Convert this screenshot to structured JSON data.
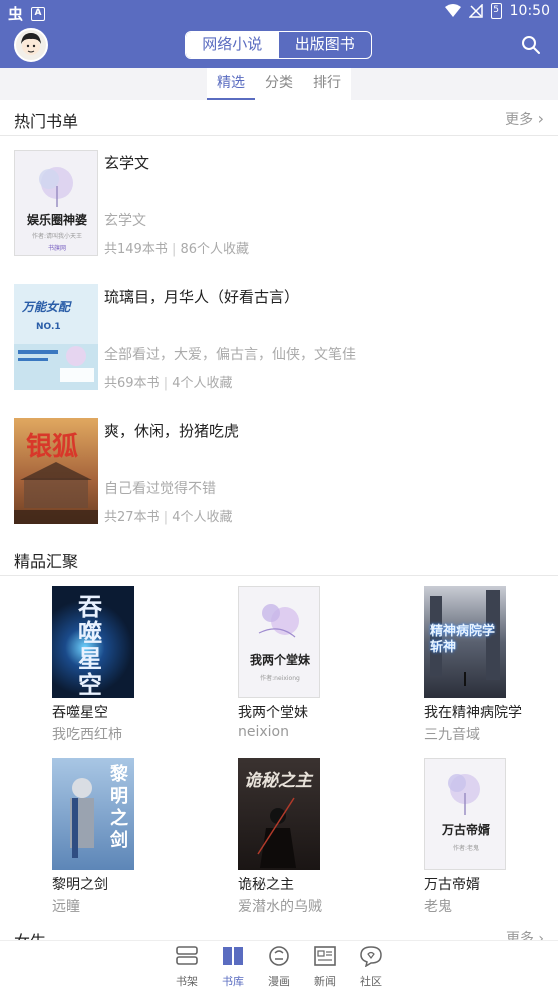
{
  "status_bar": {
    "left_glyph": "虫",
    "box_glyph": "A",
    "battery": "5",
    "time": "10:50"
  },
  "header": {
    "tabs": [
      {
        "label": "网络小说"
      },
      {
        "label": "出版图书"
      }
    ]
  },
  "sub_tabs": [
    {
      "label": "精选"
    },
    {
      "label": "分类"
    },
    {
      "label": "排行"
    }
  ],
  "hot_lists": {
    "title": "热门书单",
    "more": "更多",
    "items": [
      {
        "title": "玄学文",
        "desc": "玄学文",
        "count": "共149本书",
        "fav": "86个人收藏",
        "cover_title": "娱乐圈神婆",
        "cover_author": "作者:请叫我小天王",
        "cover_badge": "书旗网",
        "cover_color": "#f2f1f6"
      },
      {
        "title": "琉璃目，月华人（好看古言）",
        "desc": "全部看过，大爱，偏古言，仙侠，文笔佳",
        "count": "共69本书",
        "fav": "4个人收藏",
        "cover_title": "万能女配",
        "cover_badge": "NO.1",
        "cover_color": "#dfeef6"
      },
      {
        "title": "爽，休闲，扮猪吃虎",
        "desc": "自己看过觉得不错",
        "count": "共27本书",
        "fav": "4个人收藏",
        "cover_title": "银狐",
        "cover_color": "#b9743f"
      }
    ]
  },
  "featured": {
    "title": "精品汇聚",
    "books": [
      {
        "title": "吞噬星空",
        "author": "我吃西红柿",
        "cover_text": "吞噬星空",
        "cover_color": "#0b1b33"
      },
      {
        "title": "我两个堂妹",
        "author": "neixion",
        "cover_text": "我两个堂妹",
        "cover_author": "作者:neixiong",
        "cover_color": "#f4f3f7"
      },
      {
        "title": "我在精神病院学",
        "author": "三九音域",
        "cover_text": "精神病院学斩神",
        "cover_color": "#3c4456"
      },
      {
        "title": "黎明之剑",
        "author": "远瞳",
        "cover_text": "黎明之剑",
        "cover_color": "#8fb2d6"
      },
      {
        "title": "诡秘之主",
        "author": "爱潜水的乌贼",
        "cover_text": "诡秘之主",
        "cover_color": "#231f1e"
      },
      {
        "title": "万古帝婿",
        "author": "老鬼",
        "cover_text": "万古帝婿",
        "cover_author": "作者:老鬼",
        "cover_color": "#f4f3f7"
      }
    ]
  },
  "next_section": {
    "title": "女生",
    "more": "更多"
  },
  "bottom_nav": [
    {
      "label": "书架",
      "icon": "bookshelf-icon"
    },
    {
      "label": "书库",
      "icon": "library-icon"
    },
    {
      "label": "漫画",
      "icon": "comic-icon"
    },
    {
      "label": "新闻",
      "icon": "news-icon"
    },
    {
      "label": "社区",
      "icon": "community-icon"
    }
  ],
  "colors": {
    "accent": "#5a6cc0",
    "muted": "#999999"
  }
}
